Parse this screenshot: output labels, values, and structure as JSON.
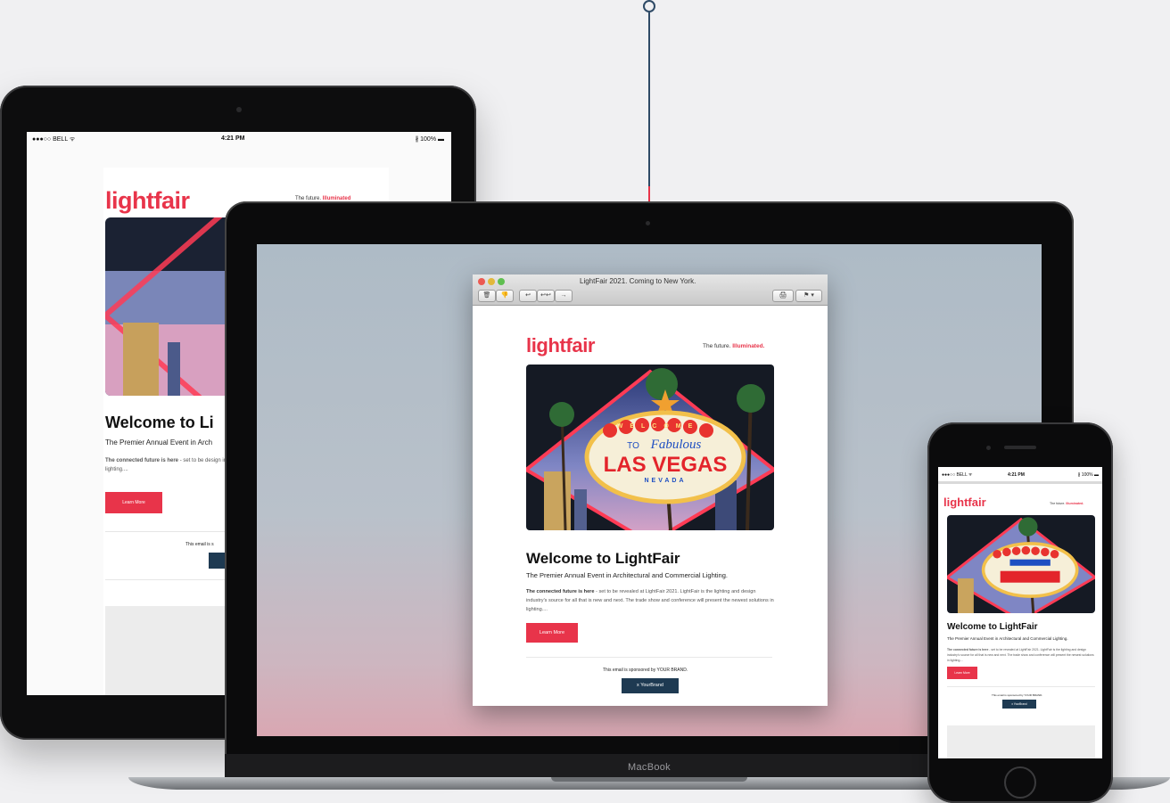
{
  "ipad": {
    "status": {
      "carrier": "●●●○○ BELL ᯤ",
      "time": "4:21 PM",
      "battery": "∦ 100% ▬"
    },
    "email": {
      "logo": "lightfair",
      "tagline_prefix": "The future.",
      "tagline_accent": "Illuminated",
      "title": "Welcome to Li",
      "subtitle": "The Premier Annual Event in Arch",
      "body_bold": "The connected future is here",
      "body": "- set to be design industry's source for all that is new the newest solutions in lighting....",
      "button": "Learn More",
      "sponsor": "This email is s"
    }
  },
  "macbook": {
    "label": "MacBook",
    "mail_window": {
      "title": "LightFair 2021. Coming to New York.",
      "toolbar": [
        "🗑",
        "👎",
        "↩",
        "↩↩",
        "→",
        "🖨",
        "⚑ ▾"
      ],
      "email": {
        "logo": "lightfair",
        "tagline_prefix": "The future.",
        "tagline_accent": "Illuminated.",
        "hero_sign_top": "WELCOME",
        "hero_sign_to": "TO",
        "hero_sign_fabulous": "Fabulous",
        "hero_sign_main": "LAS VEGAS",
        "hero_sign_bottom": "NEVADA",
        "title": "Welcome to LightFair",
        "subtitle": "The Premier Annual Event in Architectural and Commercial Lighting.",
        "body_bold": "The connected future is here",
        "body": " - set to be revealed at LightFair 2021. LightFair is the lighting and design industry's source for all that is new and next. The trade show and conference will present the newest solutions in lighting....",
        "button": "Learn More",
        "sponsor": "This email is sponsored by YOUR BRAND.",
        "sponsor_button": "x YourBrand"
      }
    }
  },
  "iphone": {
    "status": {
      "carrier": "●●●○○ BELL ᯤ",
      "time": "4:21 PM",
      "battery": "∦ 100% ▬"
    },
    "email": {
      "logo": "lightfair",
      "tagline_prefix": "The future.",
      "tagline_accent": "Illuminated.",
      "title": "Welcome to LightFair",
      "subtitle": "The Premier Annual Event in Architectural and Commercial Lighting.",
      "body_bold": "The connected future is here",
      "body": " - set to be revealed at LightFair 2021. LightFair is the lighting and design industry's source for all that is new and next. The trade show and conference will present the newest solutions in lighting....",
      "button": "Learn More",
      "sponsor": "This email is sponsored by YOUR BRAND.",
      "sponsor_button": "x YourBrand"
    }
  },
  "colors": {
    "brand_red": "#e8344a",
    "navy": "#1e3a52",
    "connector": "#2e4a66"
  }
}
